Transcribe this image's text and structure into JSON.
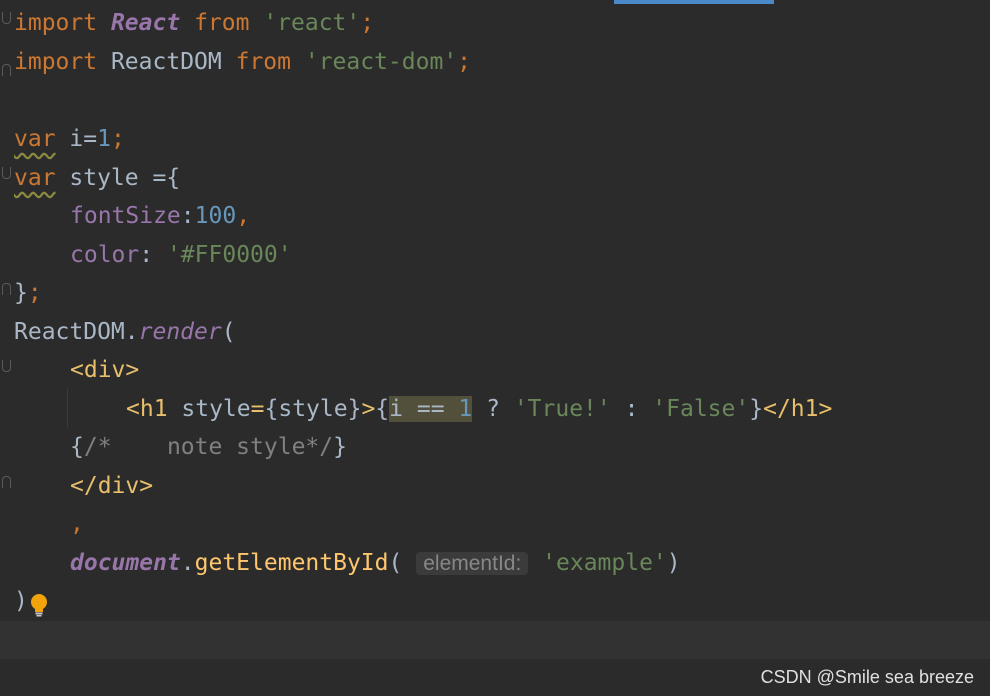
{
  "editor": {
    "lines": {
      "l1": {
        "import1": "import",
        "react_name": "React",
        "from1": "from",
        "react_str": "'react'",
        "semi1": ";"
      },
      "l2": {
        "import2": "import",
        "reactdom_name": "ReactDOM",
        "from2": "from",
        "reactdom_str": "'react-dom'",
        "semi2": ";"
      },
      "l4": {
        "var1": "var",
        "i_decl": " i=",
        "one": "1",
        "semi4": ";"
      },
      "l5": {
        "var2": "var",
        "style_decl": " style ={"
      },
      "l6": {
        "fontsize_key": "fontSize",
        "colon6": ":",
        "num100": "100",
        "comma6": ","
      },
      "l7": {
        "color_key": "color",
        "colon7": ": ",
        "color_str": "'#FF0000'"
      },
      "l8": {
        "close_brace": "}",
        "semi8": ";"
      },
      "l9": {
        "reactdom_obj": "ReactDOM.",
        "render_method": "render",
        "paren_open": "("
      },
      "l10": {
        "div_open": "<div>"
      },
      "l11": {
        "h1_open": "<h1 ",
        "style_attr": "style",
        "eq11": "=",
        "style_expr": "{style}",
        "gt11": ">",
        "brace11": "{",
        "cond_i": "i == ",
        "cond_one": "1",
        "q": " ? ",
        "true_str": "'True!'",
        "colon11": " : ",
        "false_str": "'False'",
        "brace11_close": "}",
        "h1_close": "</h1>"
      },
      "l12": {
        "cmt_open": "{",
        "cmt_body": "/*    note style*/",
        "cmt_close": "}"
      },
      "l13": {
        "div_close": "</div>"
      },
      "l14": {
        "comma14": ","
      },
      "l15": {
        "document_obj": "document",
        "dot15": ".",
        "get_method": "getElementById",
        "paren15": "(",
        "hint": "elementId:",
        "example_str": "'example'",
        "paren15_close": ")"
      },
      "l16": {
        "final_paren": ")"
      }
    }
  },
  "watermark": "CSDN @Smile sea breeze",
  "colors": {
    "background": "#2b2b2b",
    "keyword": "#cc7832",
    "string": "#6a8759",
    "number": "#6897bb",
    "property": "#9876aa",
    "tag": "#e8bf6a"
  },
  "icons": {
    "bulb": "lightbulb-icon"
  }
}
